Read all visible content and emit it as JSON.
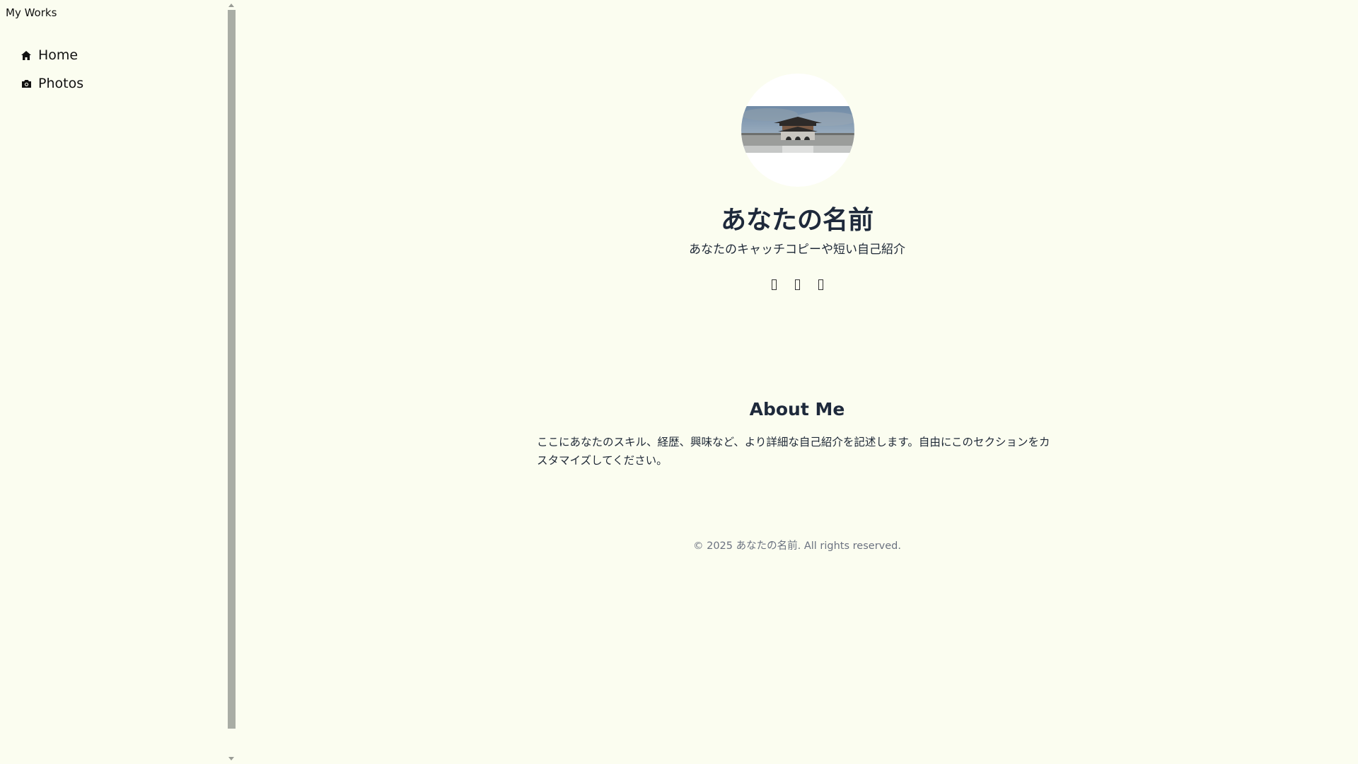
{
  "sidebar": {
    "brand": "My Works",
    "items": [
      {
        "label": "Home",
        "icon": "home-icon"
      },
      {
        "label": "Photos",
        "icon": "camera-icon"
      }
    ]
  },
  "profile": {
    "name": "あなたの名前",
    "tagline": "あなたのキャッチコピーや短い自己紹介",
    "socials": [
      "social-icon",
      "social-icon",
      "social-icon"
    ]
  },
  "about": {
    "title": "About Me",
    "text": "ここにあなたのスキル、経歴、興味など、より詳細な自己紹介を記述します。自由にこのセクションをカスタマイズしてください。"
  },
  "footer": {
    "text": "© 2025 あなたの名前. All rights reserved."
  }
}
